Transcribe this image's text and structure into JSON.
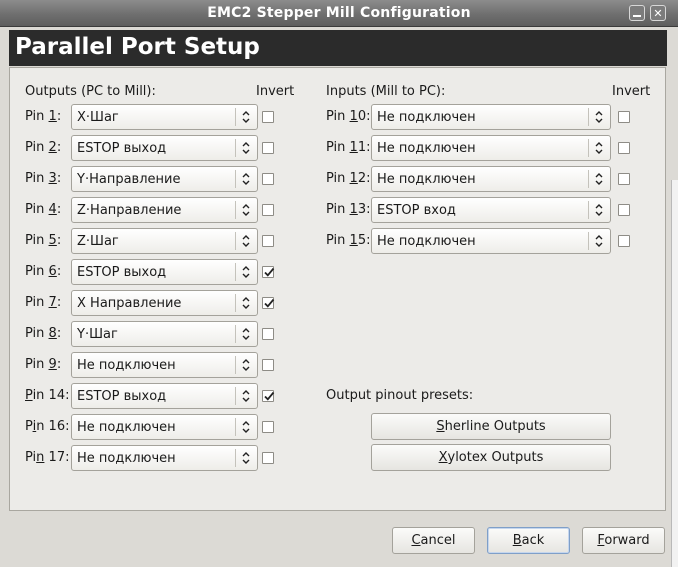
{
  "window": {
    "title": "EMC2 Stepper Mill Configuration",
    "close_glyph": "✕"
  },
  "header": {
    "title": "Parallel Port Setup"
  },
  "outputs": {
    "section_label": "Outputs (PC to Mill):",
    "invert_label": "Invert",
    "rows": [
      {
        "pre": "Pin ",
        "key": "1",
        "post": ":",
        "value": "X·Шаг",
        "checked": false
      },
      {
        "pre": "Pin ",
        "key": "2",
        "post": ":",
        "value": "ESTOP выход",
        "checked": false
      },
      {
        "pre": "Pin ",
        "key": "3",
        "post": ":",
        "value": "Y·Направление",
        "checked": false
      },
      {
        "pre": "Pin ",
        "key": "4",
        "post": ":",
        "value": "Z·Направление",
        "checked": false
      },
      {
        "pre": "Pin ",
        "key": "5",
        "post": ":",
        "value": "Z·Шаг",
        "checked": false
      },
      {
        "pre": "Pin ",
        "key": "6",
        "post": ":",
        "value": "ESTOP выход",
        "checked": true
      },
      {
        "pre": "Pin ",
        "key": "7",
        "post": ":",
        "value": "X Направление",
        "checked": true
      },
      {
        "pre": "Pin ",
        "key": "8",
        "post": ":",
        "value": "Y·Шаг",
        "checked": false
      },
      {
        "pre": "Pin ",
        "key": "9",
        "post": ":",
        "value": "Не подключен",
        "checked": false
      },
      {
        "pre": "",
        "key": "P",
        "post": "in 14:",
        "value": "ESTOP выход",
        "checked": true
      },
      {
        "pre": "P",
        "key": "i",
        "post": "n 16:",
        "value": "Не подключен",
        "checked": false
      },
      {
        "pre": "Pi",
        "key": "n",
        "post": " 17:",
        "value": "Не подключен",
        "checked": false
      }
    ]
  },
  "inputs": {
    "section_label": "Inputs (Mill to PC):",
    "invert_label": "Invert",
    "rows": [
      {
        "pre": "Pin ",
        "key": "1",
        "post": "0:",
        "value": "Не подключен",
        "checked": false
      },
      {
        "pre": "Pin ",
        "key": "1",
        "post": "1:",
        "value": "Не подключен",
        "checked": false
      },
      {
        "pre": "Pin ",
        "key": "1",
        "post": "2:",
        "value": "Не подключен",
        "checked": false
      },
      {
        "pre": "Pin ",
        "key": "1",
        "post": "3:",
        "value": "ESTOP вход",
        "checked": false
      },
      {
        "pre": "Pin ",
        "key": "1",
        "post": "5:",
        "value": "Не подключен",
        "checked": false
      }
    ]
  },
  "presets": {
    "label": "Output pinout presets:",
    "sherline": {
      "key": "S",
      "rest": "herline Outputs"
    },
    "xylotex": {
      "key": "X",
      "rest": "ylotex Outputs"
    }
  },
  "footer": {
    "cancel": {
      "key": "C",
      "rest": "ancel"
    },
    "back": {
      "key": "B",
      "rest": "ack"
    },
    "forward": {
      "key": "F",
      "rest": "orward"
    }
  }
}
